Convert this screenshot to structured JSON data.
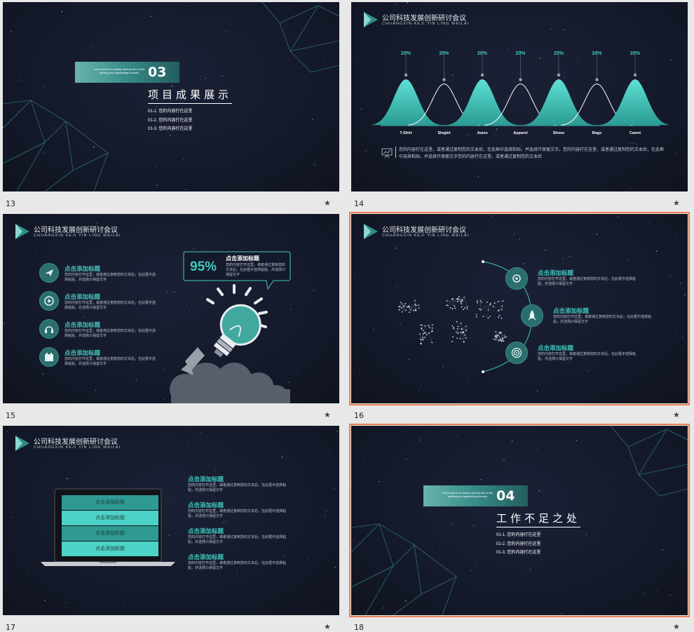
{
  "slides": [
    {
      "number": "13",
      "selected": false,
      "section_tiny": "Lorem Ipsum is simply dummy text of the printing and typesetting industry",
      "section_num": "03",
      "section_title": "项目成果展示",
      "items": [
        "01-1. 您的内容打在这里",
        "01-2. 您的内容打在这里",
        "01-3. 您的内容打在这里"
      ]
    },
    {
      "number": "14",
      "selected": false,
      "brand_title": "公司科技发展创新研讨会议",
      "brand_sub": "CHUANGXIN KEJI YIN LING WEILAI",
      "chart_percent": [
        "20%",
        "20%",
        "20%",
        "20%",
        "20%",
        "20%",
        "20%"
      ],
      "note": "您的内容打在这里，或者通过复制您的文本后，在此框中选择粘贴，并选择只保留文字。您的内容打在这里，或者通过复制您的文本后，在此框中选择粘贴，并选择只保留文字您的内容打在这里，或者通过复制您的文本后"
    },
    {
      "number": "15",
      "selected": false,
      "brand_title": "公司科技发展创新研讨会议",
      "brand_sub": "CHUANGXIN KEJI YIN LING WEILAI",
      "list": [
        {
          "title": "点击添加标题",
          "text": "您的内容打开这里，或者通过复制您的文本后，在此框中选择粘贴，并选择只保留文字"
        },
        {
          "title": "点击添加标题",
          "text": "您的内容打开这里，或者通过复制您的文本后，在此框中选择粘贴，并选择只保留文字"
        },
        {
          "title": "点击添加标题",
          "text": "您的内容打开这里，或者通过复制您的文本后，在此框中选择粘贴，并选择只保留文字"
        },
        {
          "title": "点击添加标题",
          "text": "您的内容打开这里，或者通过复制您的文本后，在此框中选择粘贴，并选择只保留文字"
        }
      ],
      "bubble_percent": "95%",
      "bubble_title": "点击添加标题",
      "bubble_text": "您的内容打开这里，或者通过复制您的文本后，在此框中选择粘贴，并选择只保留文字"
    },
    {
      "number": "16",
      "selected": true,
      "brand_title": "公司科技发展创新研讨会议",
      "brand_sub": "CHUANGXIN KEJI YIN LING WEILAI",
      "list": [
        {
          "title": "点击添加标题",
          "text": "您的内容打开这里，或者通过复制您的文本后，在此框中选择粘贴，并选择只保留文字"
        },
        {
          "title": "点击添加标题",
          "text": "您的内容打开这里，或者通过复制您的文本后，在此框中选择粘贴，并选择只保留文字"
        },
        {
          "title": "点击添加标题",
          "text": "您的内容打开这里，或者通过复制您的文本后，在此框中选择粘贴，并选择只保留文字"
        }
      ]
    },
    {
      "number": "17",
      "selected": false,
      "brand_title": "公司科技发展创新研讨会议",
      "brand_sub": "CHUANGXIN KEJI YIN LING WEILAI",
      "bars": [
        "点击添加标题",
        "点击添加标题",
        "点击添加标题",
        "点击添加标题"
      ],
      "list": [
        {
          "title": "点击添加标题",
          "text": "您的内容打开这里，或者通过复制您的文本后，在此框中选择粘贴，并选择只保留文字"
        },
        {
          "title": "点击添加标题",
          "text": "您的内容打开这里，或者通过复制您的文本后，在此框中选择粘贴，并选择只保留文字"
        },
        {
          "title": "点击添加标题",
          "text": "您的内容打开这里，或者通过复制您的文本后，在此框中选择粘贴，并选择只保留文字"
        },
        {
          "title": "点击添加标题",
          "text": "您的内容打开这里，或者通过复制您的文本后，在此框中选择粘贴，并选择只保留文字"
        }
      ]
    },
    {
      "number": "18",
      "selected": true,
      "section_tiny": "Lorem Ipsum is simply dummy text of the printing and typesetting industry",
      "section_num": "04",
      "section_title": "工作不足之处",
      "items": [
        "01-1. 您的内容打在这里",
        "01-2. 您的内容打在这里",
        "01-3. 您的内容打在这里"
      ]
    }
  ],
  "chart_data": {
    "type": "area",
    "categories": [
      "T-Shirt",
      "Singlet",
      "Jeans",
      "Apparel",
      "Shoes",
      "Bags",
      "Cawet"
    ],
    "values": [
      20,
      20,
      20,
      20,
      20,
      20,
      20
    ],
    "unit": "%"
  },
  "colors": {
    "accent": "#41c8be",
    "bg": "#151a2c",
    "selection": "#e87e54"
  }
}
